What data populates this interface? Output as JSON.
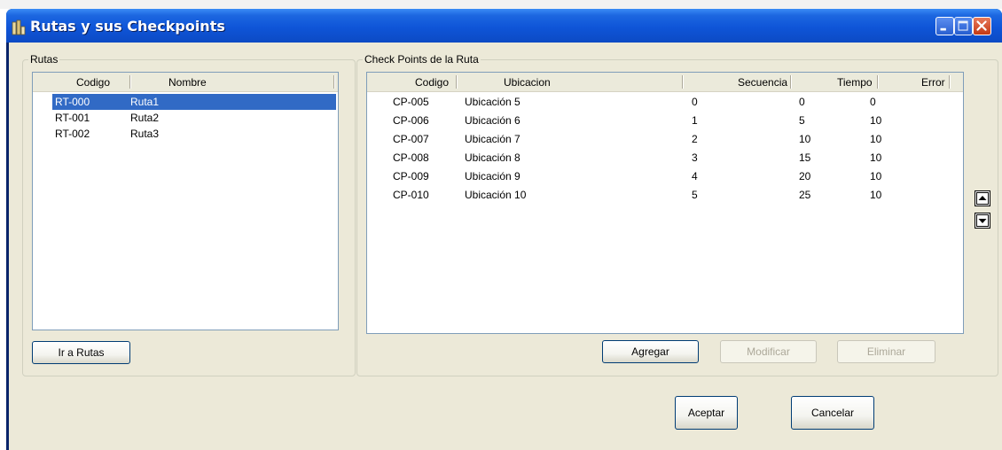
{
  "window": {
    "title": "Rutas y sus Checkpoints",
    "title_bar_color": "#0f55d8",
    "close_color": "#c33914"
  },
  "rutas": {
    "group_label": "Rutas",
    "columns": [
      "Codigo",
      "Nombre"
    ],
    "rows": [
      {
        "codigo": "RT-000",
        "nombre": "Ruta1",
        "selected": true
      },
      {
        "codigo": "RT-001",
        "nombre": "Ruta2",
        "selected": false
      },
      {
        "codigo": "RT-002",
        "nombre": "Ruta3",
        "selected": false
      }
    ],
    "button_label": "Ir a Rutas"
  },
  "checkpoints": {
    "group_label": "Check Points de la Ruta",
    "columns": [
      "Codigo",
      "Ubicacion",
      "Secuencia",
      "Tiempo",
      "Error"
    ],
    "rows": [
      {
        "codigo": "CP-005",
        "ubicacion": "Ubicación 5",
        "col3": "0",
        "secuencia": "0",
        "tiempo": "0"
      },
      {
        "codigo": "CP-006",
        "ubicacion": "Ubicación 6",
        "col3": "1",
        "secuencia": "5",
        "tiempo": "10"
      },
      {
        "codigo": "CP-007",
        "ubicacion": "Ubicación 7",
        "col3": "2",
        "secuencia": "10",
        "tiempo": "10"
      },
      {
        "codigo": "CP-008",
        "ubicacion": "Ubicación 8",
        "col3": "3",
        "secuencia": "15",
        "tiempo": "10"
      },
      {
        "codigo": "CP-009",
        "ubicacion": "Ubicación 9",
        "col3": "4",
        "secuencia": "20",
        "tiempo": "10"
      },
      {
        "codigo": "CP-010",
        "ubicacion": "Ubicación 10",
        "col3": "5",
        "secuencia": "25",
        "tiempo": "10"
      }
    ],
    "buttons": {
      "agregar": "Agregar",
      "modificar": "Modificar",
      "eliminar": "Eliminar"
    },
    "move_up_icon": "arrow-up-icon",
    "move_down_icon": "arrow-down-icon"
  },
  "footer": {
    "aceptar": "Aceptar",
    "cancelar": "Cancelar"
  },
  "colors": {
    "selection": "#316ac5",
    "dialog_bg": "#ece9d8",
    "list_border": "#7f9db9"
  }
}
